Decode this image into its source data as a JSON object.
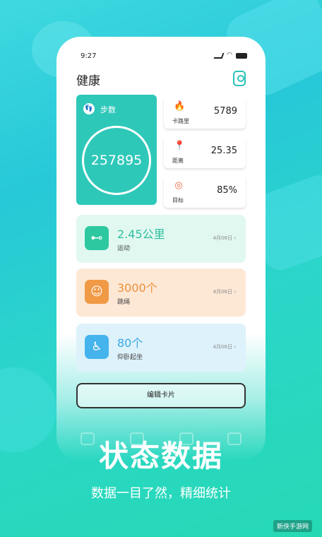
{
  "status_bar": {
    "time": "9:27"
  },
  "header": {
    "title": "健康"
  },
  "steps_card": {
    "label": "步数",
    "value": "257895"
  },
  "stats": [
    {
      "icon": "flame-icon",
      "label": "卡路里",
      "value": "5789",
      "color": "#f0643c"
    },
    {
      "icon": "location-pin-icon",
      "label": "距离",
      "value": "25.35",
      "color": "#2d6bd8"
    },
    {
      "icon": "target-icon",
      "label": "目标",
      "value": "85%",
      "color": "#f0643c"
    }
  ],
  "activities": [
    {
      "icon": "dumbbell-icon",
      "value": "2.45公里",
      "name": "运动",
      "date": "4月06日"
    },
    {
      "icon": "jump-rope-icon",
      "value": "3000个",
      "name": "跳绳",
      "date": "4月06日"
    },
    {
      "icon": "situp-icon",
      "value": "80个",
      "name": "仰卧起坐",
      "date": "4月06日"
    }
  ],
  "edit_button": {
    "label": "编辑卡片"
  },
  "promo": {
    "headline": "状态数据",
    "subtitle": "数据一目了然，精细统计"
  },
  "watermark": {
    "text": "新侠手游网"
  }
}
